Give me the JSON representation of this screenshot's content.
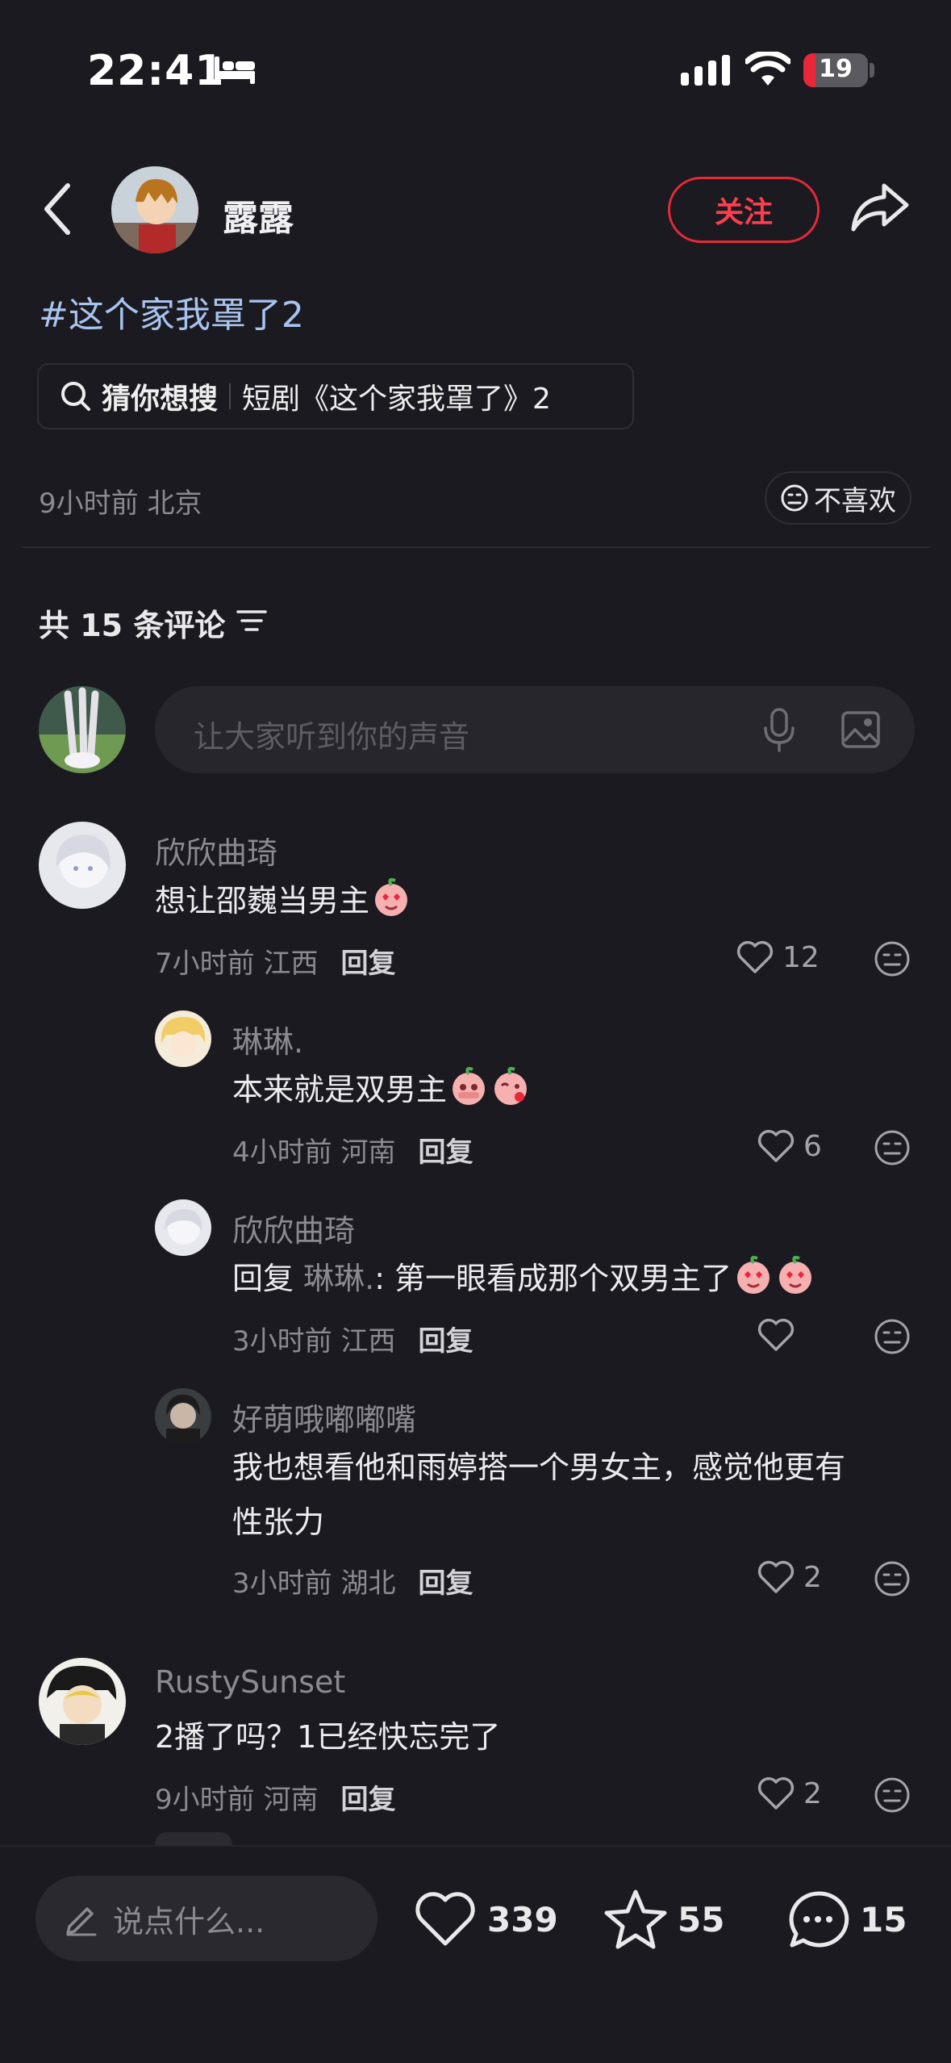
{
  "status_bar": {
    "time": "22:41",
    "battery": "19",
    "battery_level": 0.19,
    "icons": [
      "bed-icon",
      "signal-icon",
      "wifi-icon",
      "battery-icon"
    ]
  },
  "header": {
    "author_name": "露露",
    "follow_label": "关注"
  },
  "post": {
    "tag": "#这个家我罩了2",
    "search_label": "猜你想搜",
    "search_query": "短剧《这个家我罩了》2",
    "meta": "9小时前 北京",
    "dislike_label": "不喜欢"
  },
  "comments_header": {
    "title": "共 15 条评论"
  },
  "comment_input": {
    "placeholder": "让大家听到你的声音"
  },
  "comments": [
    {
      "user": "欣欣曲琦",
      "text": "想让邵巍当男主",
      "meta": "7小时前 江西",
      "reply": "回复",
      "likes": "12"
    },
    {
      "user": "琳琳.",
      "text": "本来就是双男主",
      "meta": "4小时前 河南",
      "reply": "回复",
      "likes": "6"
    },
    {
      "user": "欣欣曲琦",
      "reply_prefix": "回复",
      "reply_to": "琳琳.",
      "text": ": 第一眼看成那个双男主了",
      "meta": "3小时前 江西",
      "reply": "回复",
      "likes": ""
    },
    {
      "user": "好萌哦嘟嘟嘴",
      "text_line1": "我也想看他和雨婷搭一个男女主，感觉他更有",
      "text_line2": "性张力",
      "meta": "3小时前 湖北",
      "reply": "回复",
      "likes": "2"
    },
    {
      "user": "RustySunset",
      "text": "2播了吗？1已经快忘完了",
      "meta": "9小时前 河南",
      "reply": "回复",
      "likes": "2"
    }
  ],
  "bottom_bar": {
    "placeholder": "说点什么...",
    "likes": "339",
    "favorites": "55",
    "comments": "15"
  },
  "colors": {
    "background": "#1b1a20",
    "accent_red": "#e8283a",
    "tag_blue": "#a8c4ee",
    "muted": "#8b8a90"
  }
}
